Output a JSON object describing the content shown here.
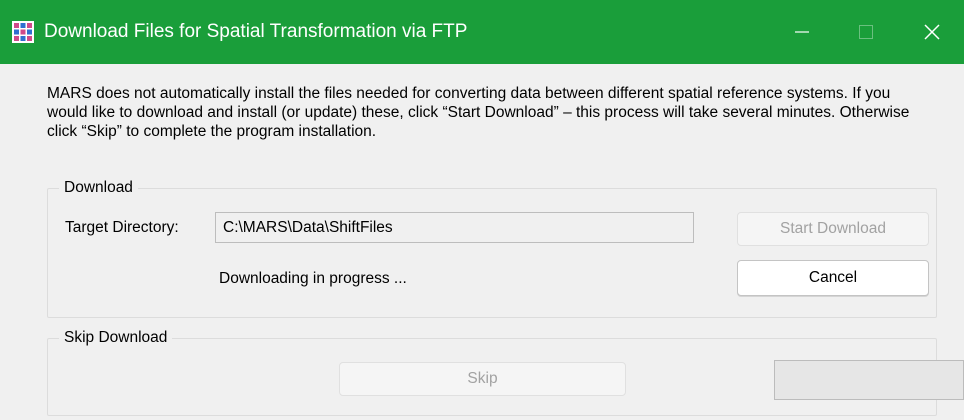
{
  "window": {
    "title": "Download Files for Spatial Transformation via FTP",
    "titlebar_color": "#1a9e3a",
    "icon": "grid-app-icon"
  },
  "message": "MARS does not automatically install the files needed for converting data between different spatial reference systems.  If you would like to download and install (or update) these, click “Start Download” – this process will take several minutes.  Otherwise click “Skip” to complete the program installation.",
  "download_group": {
    "title": "Download",
    "target_label": "Target Directory:",
    "target_value": "C:\\MARS\\Data\\ShiftFiles",
    "status": "Downloading in progress ...",
    "start_button": "Start Download",
    "cancel_button": "Cancel"
  },
  "skip_group": {
    "title": "Skip Download",
    "skip_button": "Skip",
    "progress": 0
  }
}
